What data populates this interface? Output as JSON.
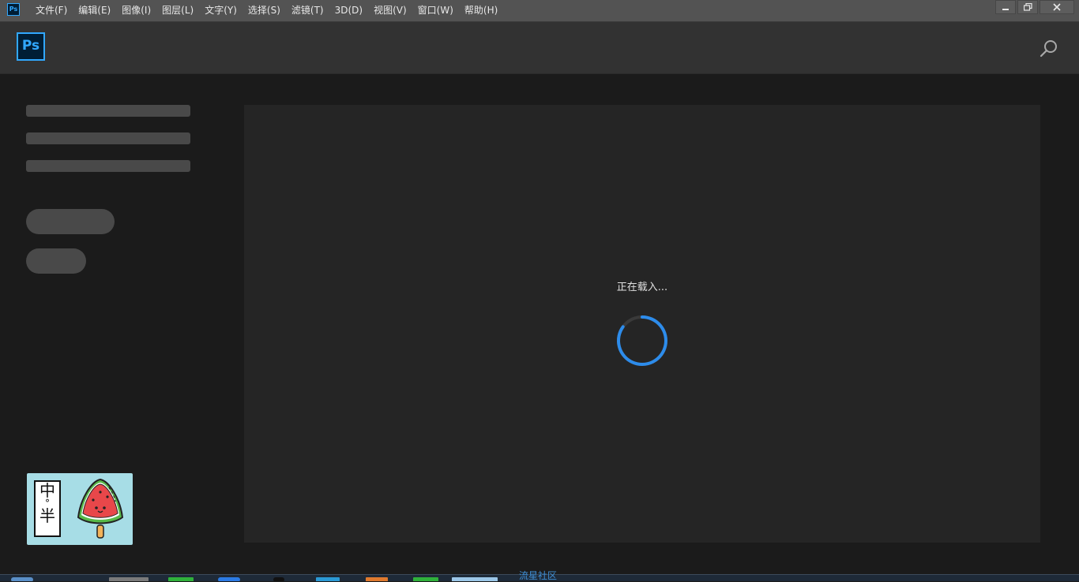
{
  "menubar": {
    "app_icon": "Ps",
    "items": [
      {
        "label": "文件(F)"
      },
      {
        "label": "编辑(E)"
      },
      {
        "label": "图像(I)"
      },
      {
        "label": "图层(L)"
      },
      {
        "label": "文字(Y)"
      },
      {
        "label": "选择(S)"
      },
      {
        "label": "滤镜(T)"
      },
      {
        "label": "3D(D)"
      },
      {
        "label": "视图(V)"
      },
      {
        "label": "窗口(W)"
      },
      {
        "label": "帮助(H)"
      }
    ],
    "window_controls": [
      "minimize-icon",
      "restore-icon",
      "close-icon"
    ]
  },
  "header": {
    "logo": "Ps",
    "search_icon": "search-icon"
  },
  "main": {
    "loading_text": "正在载入..."
  },
  "sticker": {
    "tag_top": "中",
    "tag_mid": "°",
    "tag_bottom": "半"
  },
  "taskbar": {
    "watermark": "流星社区"
  },
  "colors": {
    "accent": "#31a8ff",
    "spinner": "#2d8ceb",
    "panel": "#252525",
    "skeleton": "#494949"
  }
}
